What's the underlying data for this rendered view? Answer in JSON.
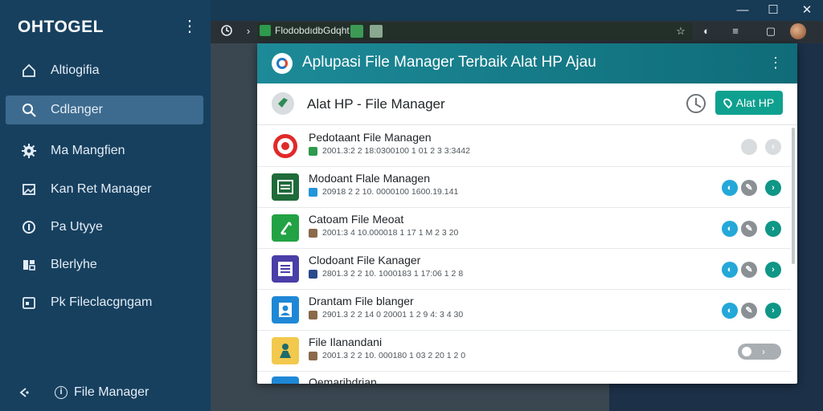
{
  "sidebar": {
    "brand": "OHTOGEL",
    "menu_glyph": "⋮",
    "items": [
      {
        "label": "Altiogifia",
        "icon": "home-icon",
        "active": false
      },
      {
        "label": "Cdlanger",
        "icon": "search-icon",
        "active": true
      },
      {
        "label": "Ma Mangfien",
        "icon": "gear-icon",
        "active": false
      },
      {
        "label": "Kan Ret Manager",
        "icon": "image-icon",
        "active": false
      },
      {
        "label": "Pa Utyye",
        "icon": "info-circle-icon",
        "active": false
      },
      {
        "label": "Blerlyhe",
        "icon": "grid-icon",
        "active": false
      },
      {
        "label": "Pk Fileclacgngam",
        "icon": "calendar-icon",
        "active": false
      }
    ],
    "footer": {
      "label": "File Manager",
      "info_glyph": "i"
    }
  },
  "browser": {
    "address": "FlodobdıdbGdqht",
    "window_controls": {
      "minimize": "—",
      "maximize": "☐",
      "close": "✕"
    },
    "toolbar_icons": [
      "star-icon",
      "shield-icon",
      "menu-lines-icon",
      "square-icon"
    ]
  },
  "dialog": {
    "title": "Aplupasi File Manager Terbaik Alat HP Ajau",
    "menu_glyph": "⋮",
    "subtitle": "Alat HP - File Manager",
    "primary_button": "Alat HP",
    "accent_color": "#0fa08f",
    "header_color": "#1d8a98",
    "files": [
      {
        "name": "Pedotaant File Managen",
        "meta": "2001.3:2 2 18:0300100 1 01 2 3 3:3442",
        "icon_color": "#e02a2a",
        "actions": "dim"
      },
      {
        "name": "Modoant Flale Managen",
        "meta": "20918 2 2 10. 0000100 1600.19.141",
        "icon_color": "#1f6b3a",
        "actions": "full"
      },
      {
        "name": "Catoam File Meoat",
        "meta": "2001:3 4 10.000018 1 17 1 M 2 3 20",
        "icon_color": "#22a245",
        "actions": "full"
      },
      {
        "name": "Clodoant File Kanager",
        "meta": "2801.3 2 2 10. 1000183 1 17:06 1 2 8",
        "icon_color": "#4a3ea8",
        "actions": "full"
      },
      {
        "name": "Drantam File blanger",
        "meta": "2901.3 2 2 14 0 20001 1 2 9 4: 3 4 30",
        "icon_color": "#1e88d6",
        "actions": "full"
      },
      {
        "name": "File Ilanandani",
        "meta": "2001.3 2 2 10. 000180 1 03 2 20 1 2 0",
        "icon_color": "#f2c94c",
        "actions": "toggle"
      },
      {
        "name": "Oemarihdrian",
        "meta": "",
        "icon_color": "#1e88d6",
        "actions": "none"
      }
    ],
    "action_glyphs": {
      "a1": "◐",
      "a2": "✎",
      "a3": "›",
      "toggle": "›"
    }
  }
}
